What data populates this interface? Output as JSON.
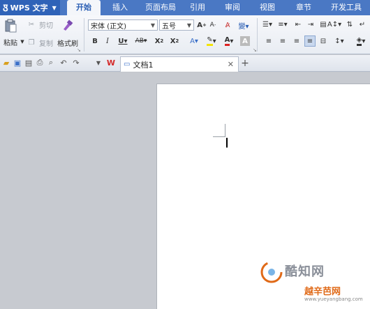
{
  "app": {
    "name": "WPS 文字"
  },
  "tabs": [
    "开始",
    "插入",
    "页面布局",
    "引用",
    "审阅",
    "视图",
    "章节",
    "开发工具"
  ],
  "active_tab": "开始",
  "clipboard": {
    "paste": "粘贴",
    "cut": "剪切",
    "copy": "复制",
    "format_painter": "格式刷"
  },
  "font": {
    "name": "宋体 (正文)",
    "size": "五号"
  },
  "doc_tab": {
    "title": "文档1"
  },
  "watermark": {
    "line1": "酷知网",
    "line2": "越辛芭网",
    "url": "www.yueyangbang.com"
  },
  "colors": {
    "tabbar": "#4a78c4",
    "app_button": "#2f63b8",
    "active_tab_text": "#2b5fb4",
    "work_area": "#c7cad0",
    "accent_orange": "#e06a18"
  }
}
